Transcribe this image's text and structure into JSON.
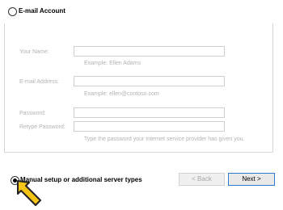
{
  "email_account": {
    "label": "E-mail Account",
    "selected": false
  },
  "fields": [
    {
      "label": "Your Name:",
      "value": "",
      "hint": "Example: Ellen Adams"
    },
    {
      "label": "E-mail Address:",
      "value": "",
      "hint": "Example: ellen@contoso.com"
    },
    {
      "label": "Password:",
      "value": ""
    },
    {
      "label": "Retype Password:",
      "value": "",
      "hint": "Type the password your Internet service provider has given you."
    }
  ],
  "manual_setup": {
    "label": "Manual setup or additional server types",
    "selected": true
  },
  "buttons": {
    "back": "< Back",
    "next": "Next >"
  },
  "colors": {
    "next_border": "#2e7bd1",
    "cursor_fill": "#f5c518"
  },
  "icons": {
    "cursor": "pointer-arrow-icon"
  }
}
